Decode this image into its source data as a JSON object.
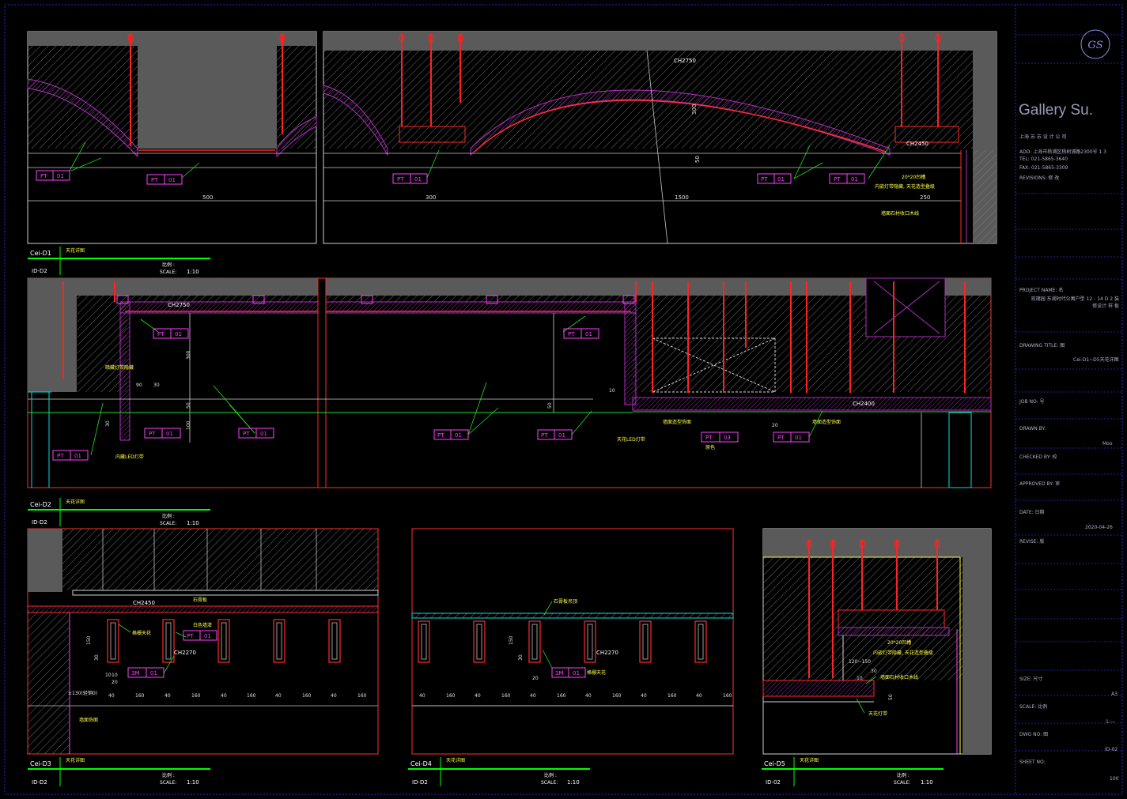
{
  "colors": {
    "background": "#000000",
    "frame": "#2a2acf",
    "wall": "#5a5a5a",
    "hatch": "#9a9a9a",
    "board": "#b030c0",
    "hanger": "#ff2222",
    "outline": "#ff3030",
    "dimension": "#e0e0e0",
    "leader": "#20e020",
    "tag": "#ff40ff",
    "annotation": "#ffff40",
    "cyan": "#00e0e0",
    "title_green": "#00ff00"
  },
  "title_block": {
    "logo_glyph": "GS",
    "company": "Gallery Su.",
    "address_lines": [
      "上海   苏 苏     设 计 公 司",
      "ADD: 上海市杨浦区杨树浦路2300号 1   3",
      "TEL: 021-5865-3640",
      "FAX: 021-5865-3309",
      "REVISIONS: 修 改"
    ],
    "project_label": "PROJECT NAME: 名",
    "project_value": "玫瑰园 东湖时代公寓户型 12 - 14 D 2 装修设计 样 板",
    "drawing_title_label": "DRAWING TITLE: 图",
    "drawing_title_value": "Cei-D1~D5天花详图",
    "job_no_label": "JOB NO: 号",
    "drawn_by_label": "DRAWN BY:",
    "drawn_by_value": "Moo",
    "checked_by_label": "CHECKED BY: 校",
    "approved_by_label": "APPROVED BY: 审",
    "date_label": "DATE: 日期",
    "date_value": "2020-04-26",
    "revise_label": "REVISE: 版",
    "size_label": "SIZE: 尺寸",
    "size_value": "A3",
    "scale_label": "SCALE: 比例",
    "scale_value": "1:---",
    "dwg_no_label": "DWG NO: 图",
    "dwg_no_value": "ID-02",
    "sheet_no_label": "SHEET NO:",
    "sheet_no_value": "100"
  },
  "views": {
    "d1": {
      "id": "Cei-D1",
      "sheet": "ID-D2",
      "title": "天花详图",
      "scale_label": "比例 :",
      "scale_word": "SCALE:",
      "scale": "1:10",
      "tags": [
        [
          "PT",
          "01"
        ],
        [
          "PT",
          "01"
        ],
        [
          "PT",
          "01"
        ],
        [
          "PT",
          "01"
        ],
        [
          "PT",
          "01"
        ]
      ],
      "dims": [
        "500",
        "300",
        "1500",
        "250",
        "300",
        "50"
      ],
      "levels": [
        "CH2750",
        "CH2450"
      ],
      "notes": [
        "20*20凹槽",
        "内嵌灯带隐藏, 天花造型叠级",
        "墙面石材收口木线"
      ]
    },
    "d2": {
      "id": "Cei-D2",
      "sheet": "ID-D2",
      "title": "天花详图",
      "scale_label": "比例 :",
      "scale_word": "SCALE:",
      "scale": "1:10",
      "tags": [
        [
          "PT",
          "01"
        ],
        [
          "PT",
          "01"
        ],
        [
          "PT",
          "01"
        ],
        [
          "PT",
          "01"
        ],
        [
          "PT",
          "01"
        ],
        [
          "PT",
          "01"
        ],
        [
          "PT",
          "01"
        ],
        [
          "PT",
          "03"
        ],
        [
          "PT",
          "01"
        ]
      ],
      "dims": [
        "300",
        "50",
        "90",
        "30",
        "30",
        "50",
        "100",
        "20",
        "10"
      ],
      "levels": [
        "CH2750",
        "CH2400"
      ],
      "notes": [
        "暗藏灯带隐藏",
        "内藏LED灯带",
        "天花LED灯带",
        "墙面造型饰面",
        "墙面造型饰面",
        "原色"
      ]
    },
    "d3": {
      "id": "Cei-D3",
      "sheet": "ID-D2",
      "title": "天花详图",
      "scale_label": "比例 :",
      "scale_word": "SCALE:",
      "scale": "1:10",
      "tags": [
        [
          "PT",
          "01"
        ],
        [
          "3M",
          "01"
        ]
      ],
      "dims": [
        "150",
        "30",
        "10",
        "10",
        "20",
        "40",
        "160",
        "40",
        "160",
        "40",
        "160",
        "40",
        "160",
        "40",
        "160"
      ],
      "levels": [
        "CH2450",
        "CH2270"
      ],
      "notes": [
        "墙面饰面",
        "格栅天花",
        "白色墙漆",
        "石膏板"
      ],
      "ceiling_note": "±130(轻钢0)"
    },
    "d4": {
      "id": "Cei-D4",
      "sheet": "ID-D2",
      "title": "天花详图",
      "scale_label": "比例 :",
      "scale_word": "SCALE:",
      "scale": "1:10",
      "tags": [
        [
          "3M",
          "01"
        ]
      ],
      "dims": [
        "150",
        "30",
        "20",
        "40",
        "160",
        "40",
        "160",
        "40",
        "160",
        "40",
        "160",
        "40",
        "160",
        "40",
        "160"
      ],
      "levels": [
        "CH2270"
      ],
      "notes": [
        "石膏板吊顶",
        "格栅天花"
      ]
    },
    "d5": {
      "id": "Cei-D5",
      "sheet": "ID-02",
      "title": "天花详图",
      "scale_label": "比例 :",
      "scale_word": "SCALE:",
      "scale": "1:10",
      "dims": [
        "120~150",
        "30",
        "10",
        "50"
      ],
      "notes": [
        "20*20凹槽",
        "内嵌灯带隐藏, 天花造型叠级",
        "墙面石材收口木线",
        "天花灯带"
      ]
    }
  }
}
